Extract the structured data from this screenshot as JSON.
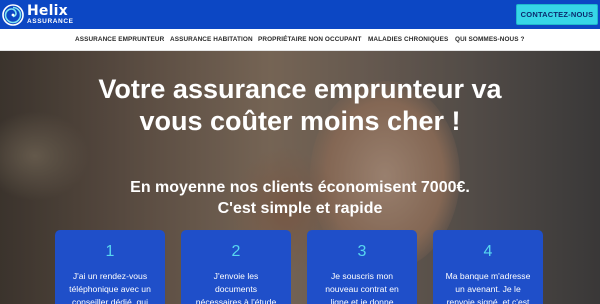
{
  "brand": {
    "name": "Helix",
    "tagline": "ASSURANCE",
    "colors": {
      "primary": "#0c47c4",
      "accent": "#36d6e7",
      "card": "#1f4fc9"
    },
    "icon": "spiral-logo-icon"
  },
  "header": {
    "cta_label": "CONTACTEZ-NOUS"
  },
  "nav": {
    "items": [
      {
        "label": "ASSURANCE EMPRUNTEUR"
      },
      {
        "label": "ASSURANCE HABITATION"
      },
      {
        "label": "PROPRIÉTAIRE NON OCCUPANT"
      },
      {
        "label": "MALADIES CHRONIQUES"
      },
      {
        "label": "QUI SOMMES-NOUS ?"
      }
    ]
  },
  "hero": {
    "headline_line1": "Votre assurance emprunteur va",
    "headline_line2": "vous coûter moins cher !",
    "sub_line1": "En moyenne nos clients économisent 7000€.",
    "sub_line2": "C'est simple et rapide"
  },
  "steps": [
    {
      "number": "1",
      "line1": "J'ai un rendez-vous",
      "line2": "téléphonique avec un",
      "line3": "conseiller dédié, qui"
    },
    {
      "number": "2",
      "line1": "J'envoie les",
      "line2": "documents",
      "line3": "nécessaires à l'étude"
    },
    {
      "number": "3",
      "line1": "Je souscris mon",
      "line2": "nouveau contrat en",
      "line3": "ligne et je donne"
    },
    {
      "number": "4",
      "line1": "Ma banque m'adresse",
      "line2": "un avenant. Je le",
      "line3": "renvoie signé, et c'est"
    }
  ]
}
